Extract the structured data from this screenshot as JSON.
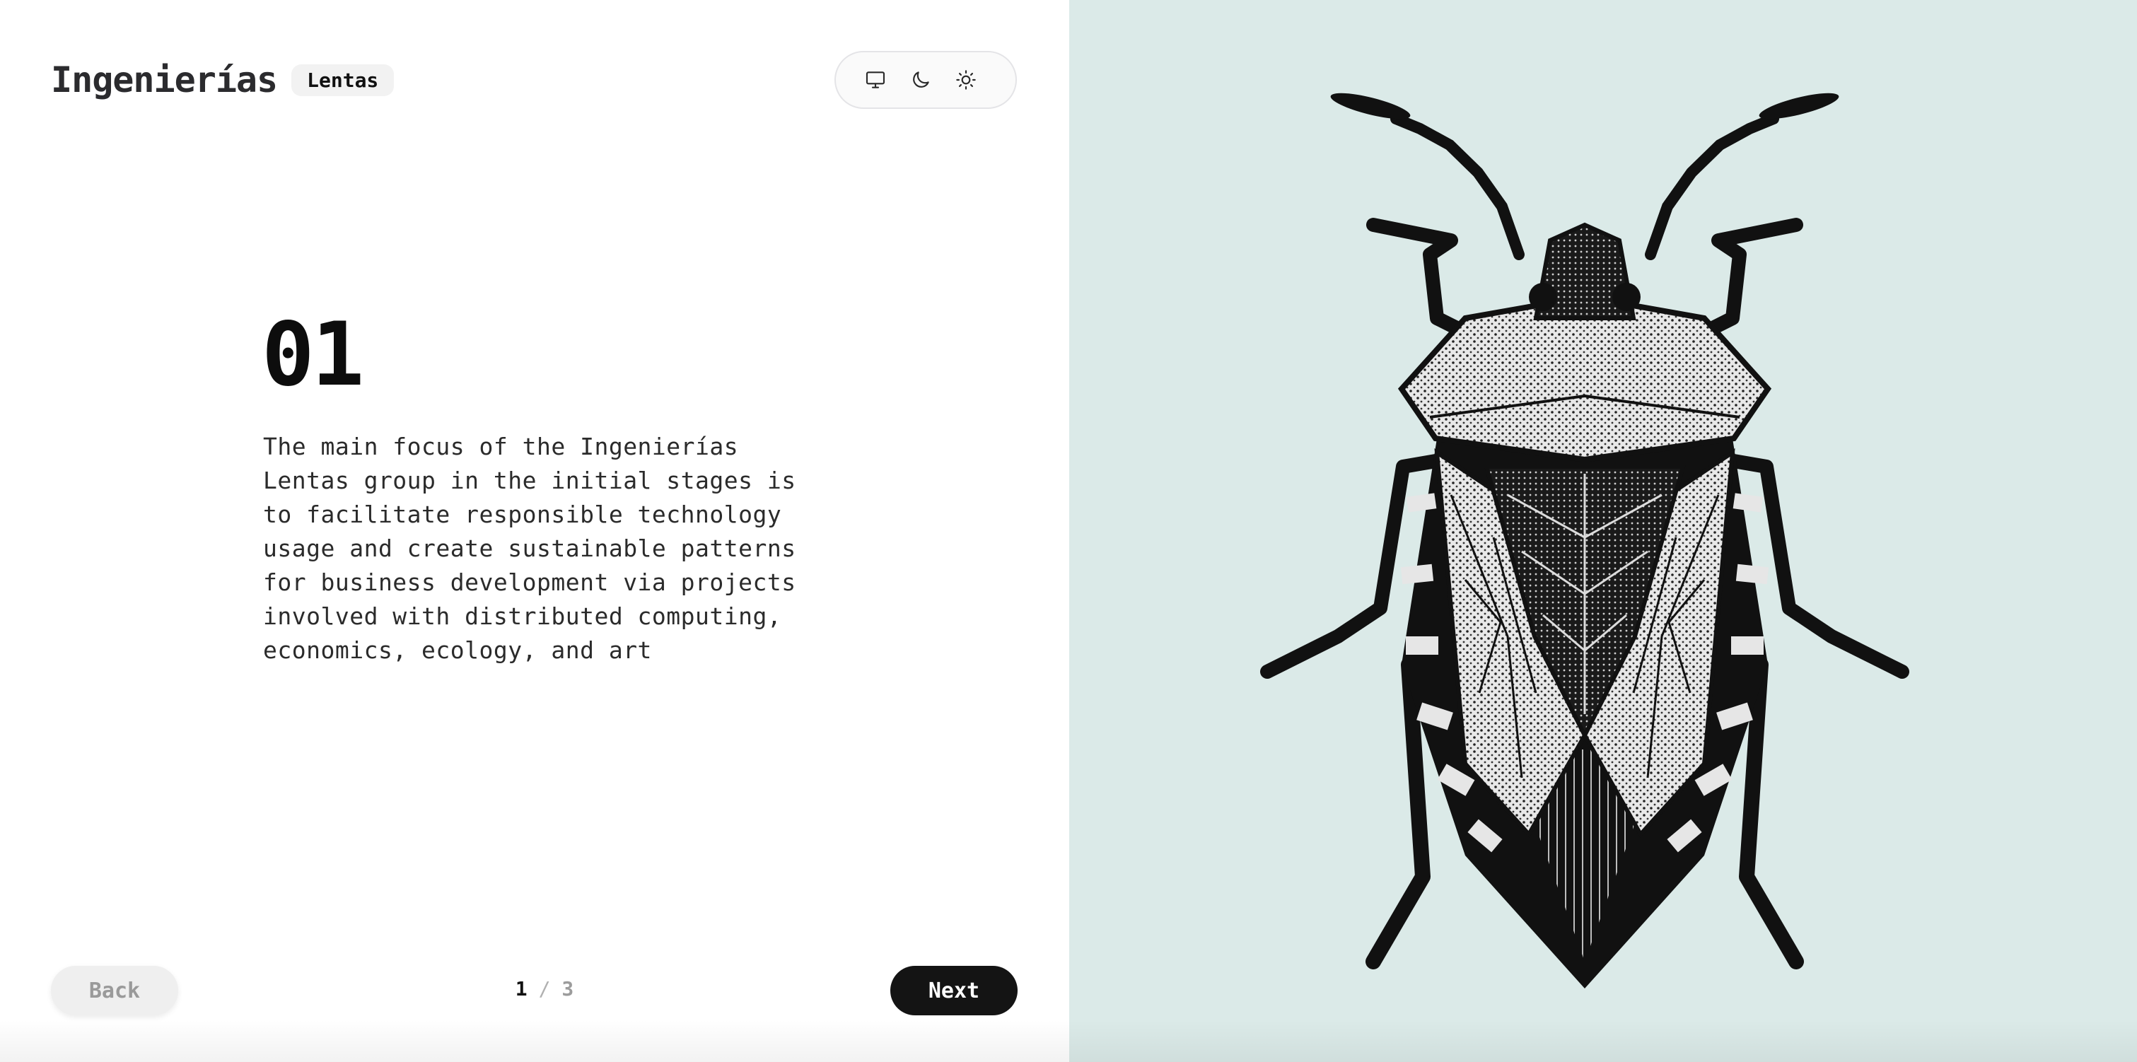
{
  "header": {
    "brand_name": "Ingenierías",
    "brand_tag": "Lentas",
    "theme_options": [
      {
        "name": "system",
        "icon": "monitor-icon"
      },
      {
        "name": "dark",
        "icon": "moon-icon"
      },
      {
        "name": "light",
        "icon": "sun-icon"
      }
    ]
  },
  "slide": {
    "number": "01",
    "text": "The main focus of the Ingenierías Lentas group in the initial stages is to facilitate responsible technology usage and create sustainable patterns for business development via projects involved with distributed computing, economics, ecology, and art"
  },
  "footer": {
    "back_label": "Back",
    "next_label": "Next",
    "current_page": "1",
    "separator": "/",
    "total_pages": "3"
  },
  "illustration": {
    "subject": "stink-bug-illustration",
    "background_color": "#dbeae8"
  },
  "colors": {
    "primary_button": "#141414",
    "secondary_button": "#efefef"
  }
}
